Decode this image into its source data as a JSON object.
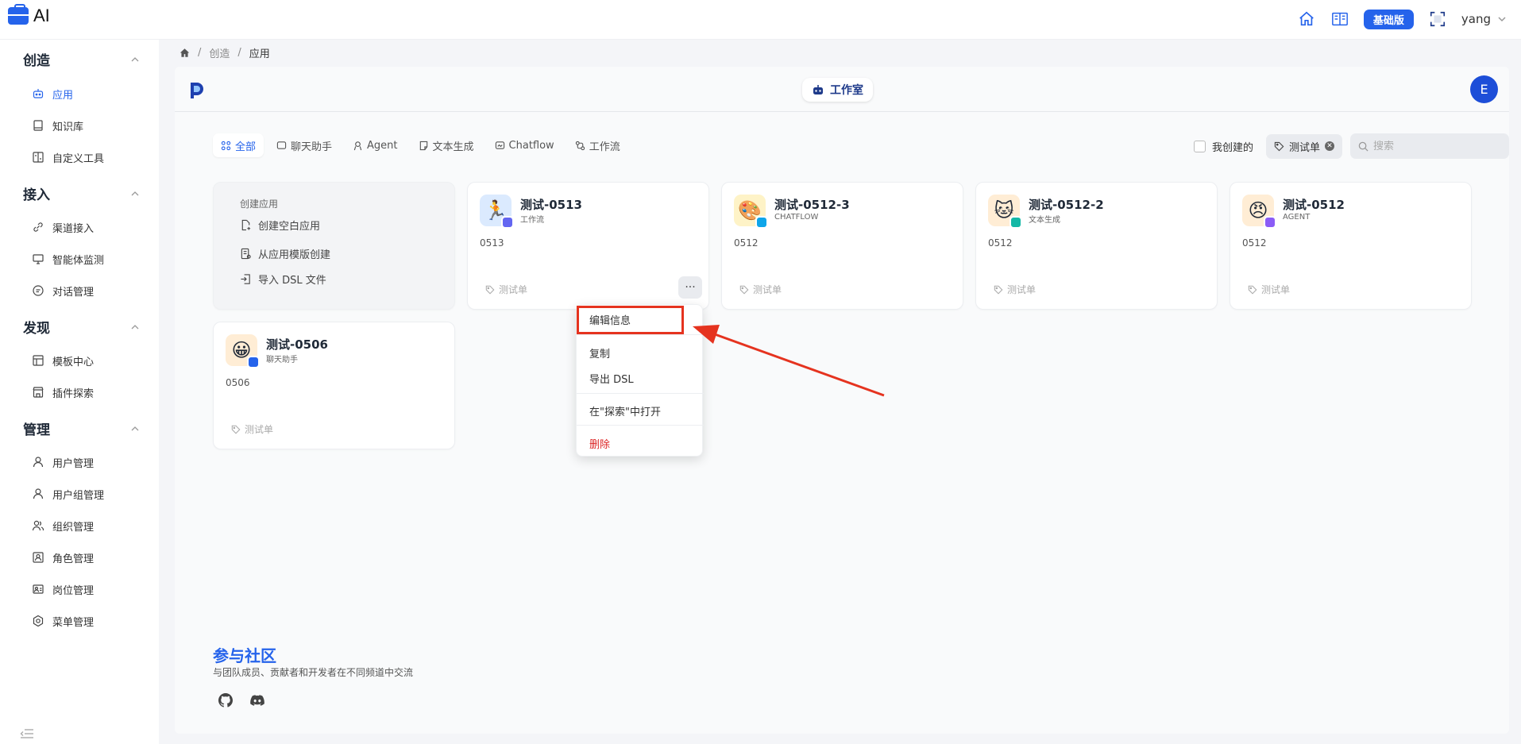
{
  "app": {
    "logo_text": "AI"
  },
  "topbar": {
    "plan": "基础版",
    "user": "yang"
  },
  "sidebar": {
    "sections": [
      {
        "title": "创造",
        "items": [
          {
            "label": "应用",
            "icon": "robot-icon",
            "active": true
          },
          {
            "label": "知识库",
            "icon": "book-icon"
          },
          {
            "label": "自定义工具",
            "icon": "tool-icon"
          }
        ]
      },
      {
        "title": "接入",
        "items": [
          {
            "label": "渠道接入",
            "icon": "link-icon"
          },
          {
            "label": "智能体监测",
            "icon": "monitor-icon"
          },
          {
            "label": "对话管理",
            "icon": "chat-icon"
          }
        ]
      },
      {
        "title": "发现",
        "items": [
          {
            "label": "模板中心",
            "icon": "template-icon"
          },
          {
            "label": "插件探索",
            "icon": "store-icon"
          }
        ]
      },
      {
        "title": "管理",
        "items": [
          {
            "label": "用户管理",
            "icon": "user-icon"
          },
          {
            "label": "用户组管理",
            "icon": "user-group-icon"
          },
          {
            "label": "组织管理",
            "icon": "org-icon"
          },
          {
            "label": "角色管理",
            "icon": "role-icon"
          },
          {
            "label": "岗位管理",
            "icon": "post-icon"
          },
          {
            "label": "菜单管理",
            "icon": "menu-gear-icon"
          }
        ]
      }
    ]
  },
  "breadcrumb": {
    "level1": "创造",
    "level2": "应用"
  },
  "header": {
    "studio": "工作室",
    "avatar_letter": "E"
  },
  "tabs": [
    "全部",
    "聊天助手",
    "Agent",
    "文本生成",
    "Chatflow",
    "工作流"
  ],
  "filters": {
    "mine": "我创建的",
    "tag": "测试单",
    "search_placeholder": "搜索"
  },
  "create_card": {
    "title": "创建应用",
    "blank": "创建空白应用",
    "template": "从应用模版创建",
    "import": "导入 DSL 文件"
  },
  "apps": [
    {
      "name": "测试-0513",
      "type": "工作流",
      "desc": "0513",
      "tag": "测试单",
      "emoji": "🏃",
      "bg": "#dbeafe",
      "badge": "#6366f1"
    },
    {
      "name": "测试-0512-3",
      "type": "CHATFLOW",
      "desc": "0512",
      "tag": "测试单",
      "emoji": "🎨",
      "bg": "#fef3c7",
      "badge": "#0ea5e9"
    },
    {
      "name": "测试-0512-2",
      "type": "文本生成",
      "desc": "0512",
      "tag": "测试单",
      "emoji": "🐱",
      "bg": "#ffedd5",
      "badge": "#14b8a6"
    },
    {
      "name": "测试-0512",
      "type": "AGENT",
      "desc": "0512",
      "tag": "测试单",
      "emoji": "😠",
      "bg": "#ffedd5",
      "badge": "#8b5cf6"
    },
    {
      "name": "测试-0506",
      "type": "聊天助手",
      "desc": "0506",
      "tag": "测试单",
      "emoji": "😀",
      "bg": "#ffedd5",
      "badge": "#2563eb"
    }
  ],
  "dropdown": {
    "edit": "编辑信息",
    "copy": "复制",
    "export": "导出 DSL",
    "open_explore": "在\"探索\"中打开",
    "delete": "删除"
  },
  "community": {
    "title": "参与社区",
    "subtitle": "与团队成员、贡献者和开发者在不同频道中交流"
  },
  "colors": {
    "primary": "#2563eb",
    "highlight": "#e5331f",
    "danger": "#dc2626"
  }
}
